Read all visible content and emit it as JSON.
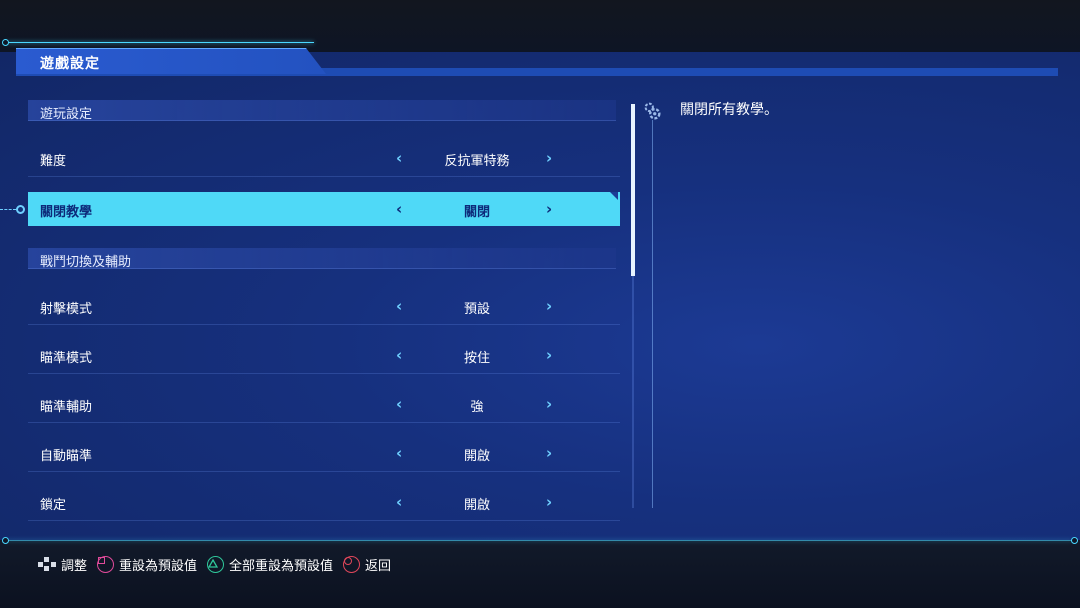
{
  "header": {
    "title": "遊戲設定"
  },
  "sections": [
    {
      "title": "遊玩設定"
    },
    {
      "title": "戰鬥切換及輔助"
    }
  ],
  "rows": [
    {
      "label": "難度",
      "value": "反抗軍特務"
    },
    {
      "label": "關閉教學",
      "value": "關閉",
      "selected": true
    },
    {
      "label": "射擊模式",
      "value": "預設"
    },
    {
      "label": "瞄準模式",
      "value": "按住"
    },
    {
      "label": "瞄準輔助",
      "value": "強"
    },
    {
      "label": "自動瞄準",
      "value": "開啟"
    },
    {
      "label": "鎖定",
      "value": "開啟"
    }
  ],
  "arrows": {
    "left": "‹",
    "right": "›"
  },
  "description": {
    "text": "關閉所有教學。",
    "icon": "gear-icon"
  },
  "footer": {
    "adjust": "調整",
    "reset_default": "重設為預設值",
    "reset_all": "全部重設為預設值",
    "back": "返回"
  },
  "colors": {
    "panel": "#16307e",
    "highlight": "#4fd9f7",
    "accent": "#4ad7ff",
    "square": "#e04a9a",
    "triangle": "#2fc79a",
    "circle": "#e0465a"
  }
}
